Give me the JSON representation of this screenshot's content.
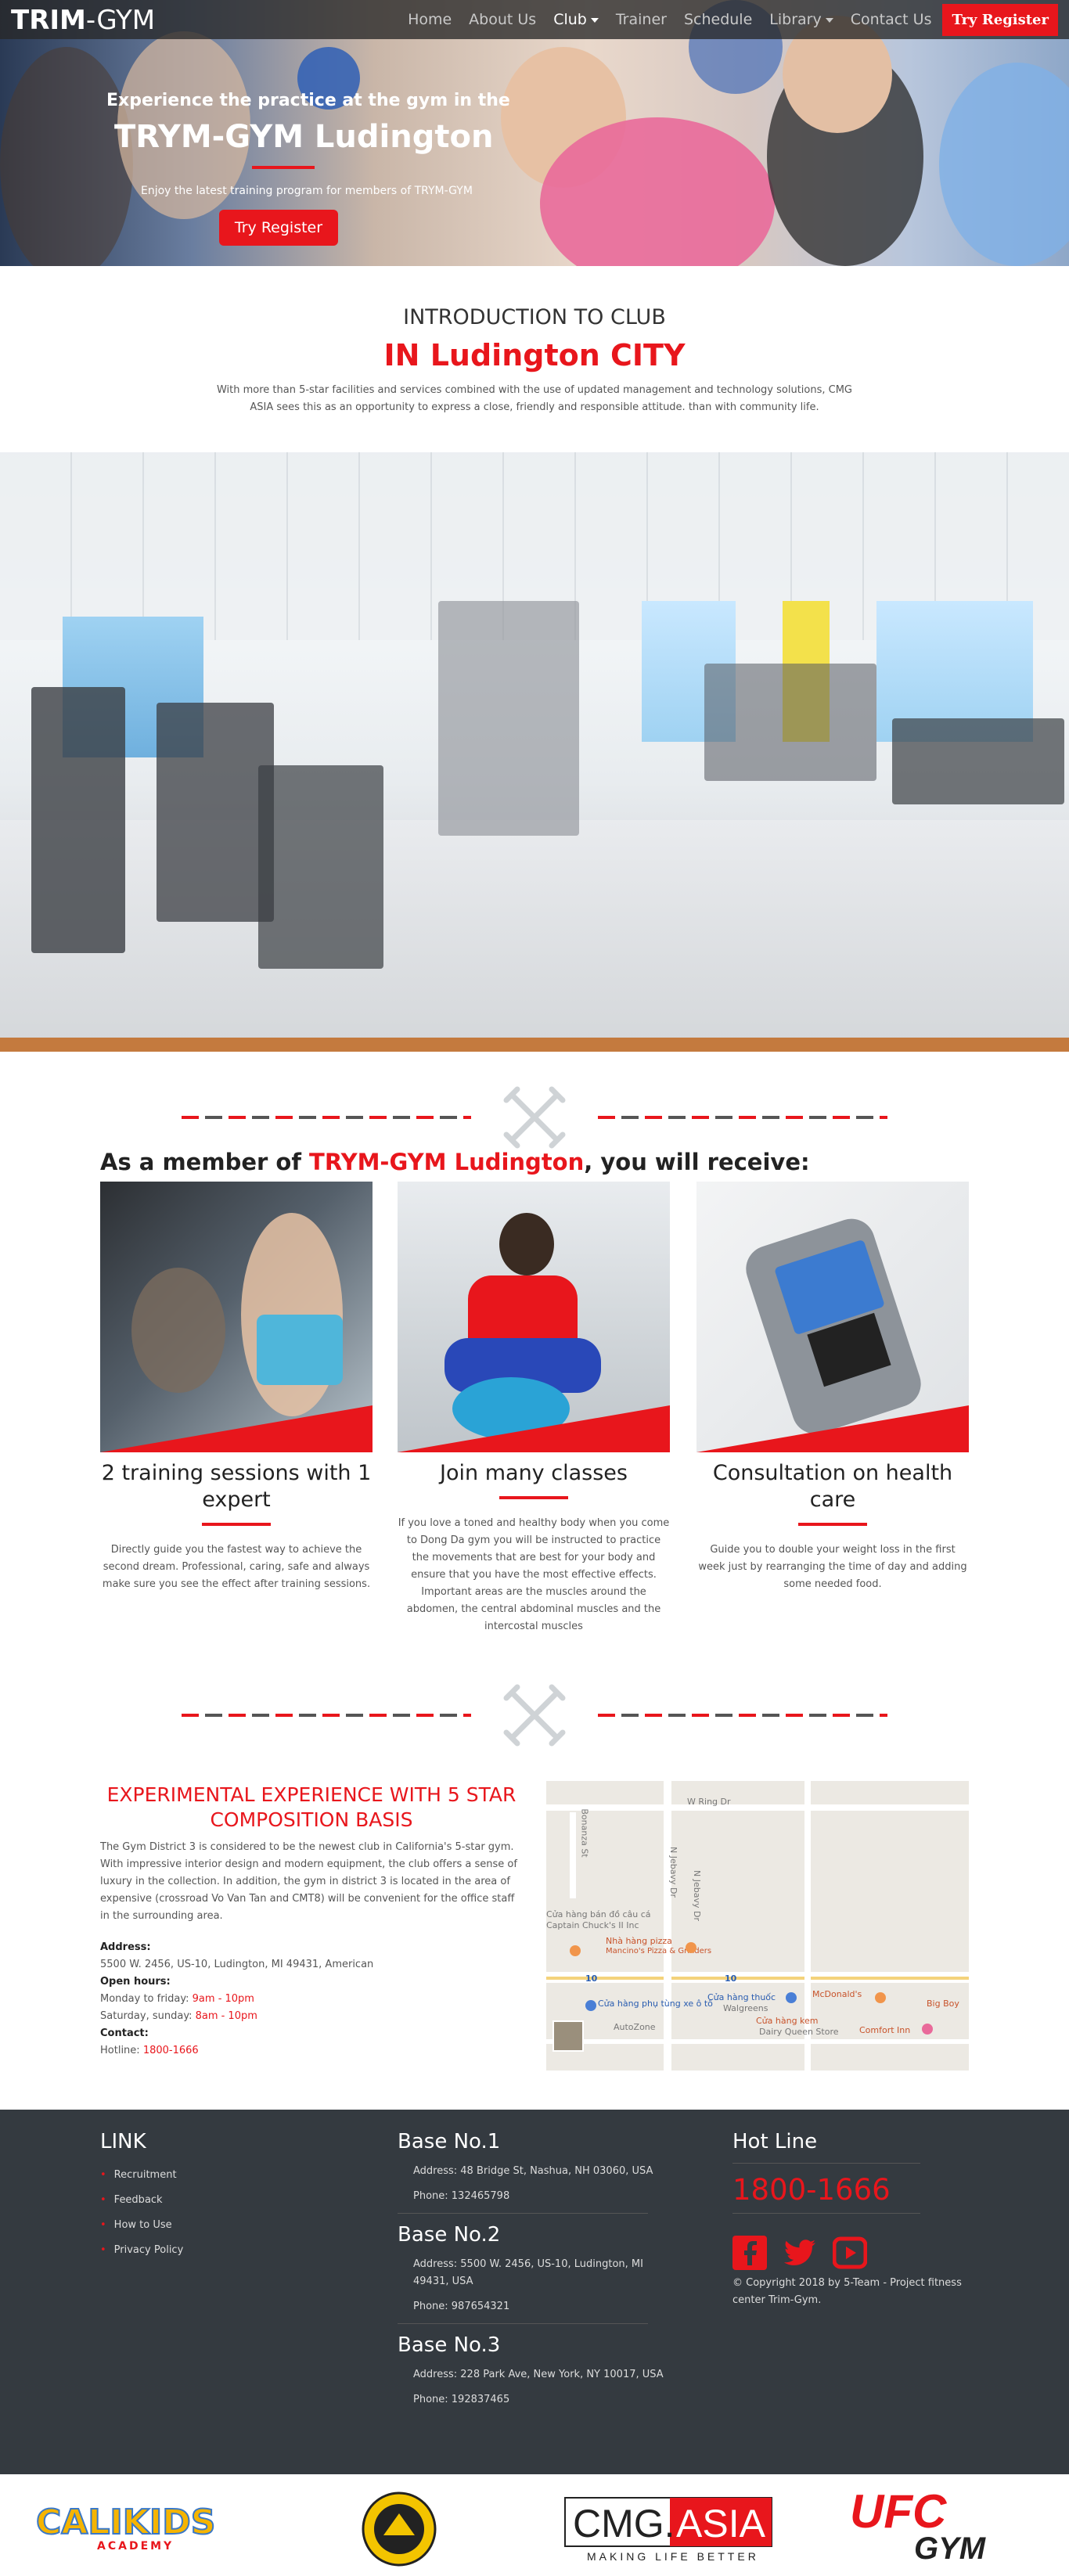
{
  "nav": {
    "brand_bold": "TRIM",
    "brand_rest": "-GYM",
    "items": [
      {
        "label": "Home"
      },
      {
        "label": "About Us"
      },
      {
        "label": "Club"
      },
      {
        "label": "Trainer"
      },
      {
        "label": "Schedule"
      },
      {
        "label": "Library"
      },
      {
        "label": "Contact Us"
      }
    ],
    "register": "Try Register"
  },
  "hero": {
    "subtitle": "Experience the practice at the gym in the",
    "title": "TRYM-GYM Ludington",
    "description": "Enjoy the latest training program for members of TRYM-GYM",
    "button": "Try Register"
  },
  "intro": {
    "heading": "INTRODUCTION TO CLUB",
    "city": "IN Ludington CITY",
    "text": "With more than 5-star facilities and services combined with the use of updated management and technology solutions, CMG ASIA sees this as an opportunity to express a close, friendly and responsible attitude. than with community life."
  },
  "member": {
    "heading_prefix": "As a member of ",
    "heading_brand": "TRYM-GYM Ludington",
    "heading_suffix": ", you will receive:",
    "cards": [
      {
        "title": "2 training sessions with 1 expert",
        "text": "Directly guide you the fastest way to achieve the second dream. Professional, caring, safe and always make sure you see the effect after training sessions."
      },
      {
        "title": "Join many classes",
        "text": "If you love a toned and healthy body when you come to Dong Da gym you will be instructed to practice the movements that are best for your body and ensure that you have the most effective effects. Important areas are the muscles around the abdomen, the central abdominal muscles and the intercostal muscles"
      },
      {
        "title": "Consultation on health care",
        "text": "Guide you to double your weight loss in the first week just by rearranging the time of day and adding some needed food."
      }
    ]
  },
  "experience": {
    "heading": "EXPERIMENTAL EXPERIENCE WITH 5 STAR COMPOSITION BASIS",
    "text": "The Gym District 3 is considered to be the newest club in California's 5-star gym. With impressive interior design and modern equipment, the club offers a sense of luxury in the collection. In addition, the gym in district 3 is located in the area of expensive (crossroad Vo Van Tan and CMT8) will be convenient for the office staff in the surrounding area.",
    "address_label": "Address:",
    "address": "5500 W. 2456, US-10, Ludington, MI 49431, American",
    "hours_label": "Open hours:",
    "weekday_label": "Monday to friday: ",
    "weekday_hours": "9am - 10pm",
    "weekend_label": "Saturday, sunday: ",
    "weekend_hours": "8am - 10pm",
    "contact_label": "Contact:",
    "hotline_label": "Hotline: ",
    "hotline": "1800-1666"
  },
  "map": {
    "labels": [
      "W Ring Dr",
      "Bonanza St",
      "N Jebavy Dr",
      "N Jebavy Dr",
      "Cửa hàng bán đồ câu cá",
      "Captain Chuck's II Inc",
      "Nhà hàng pizza",
      "Mancino's Pizza & Grinders",
      "Cửa hàng phụ tùng xe ô tô",
      "AutoZone",
      "Cửa hàng thuốc",
      "Walgreens",
      "Cửa hàng kem",
      "Dairy Queen Store",
      "McDonald's",
      "Big Boy",
      "Comfort Inn",
      "10",
      "10"
    ]
  },
  "footer": {
    "link_heading": "LINK",
    "links": [
      "Recruitment",
      "Feedback",
      "How to Use",
      "Privacy Policy"
    ],
    "bases": [
      {
        "title": "Base No.1",
        "address": "Address: 48 Bridge St, Nashua, NH 03060, USA",
        "phone": "Phone: 132465798"
      },
      {
        "title": "Base No.2",
        "address": "Address: 5500 W. 2456, US-10, Ludington, MI 49431, USA",
        "phone": "Phone: 987654321"
      },
      {
        "title": "Base No.3",
        "address": "Address: 228 Park Ave, New York, NY 10017, USA",
        "phone": "Phone: 192837465"
      }
    ],
    "hotline_heading": "Hot Line",
    "hotline": "1800-1666",
    "copyright": "© Copyright 2018 by 5-Team - Project fitness center Trim-Gym."
  },
  "partners": {
    "calikids": "CALIKIDS",
    "calikids_sub": "ACADEMY",
    "cmg_left": "CMG.",
    "cmg_right": "ASIA",
    "cmg_tagline": "MAKING LIFE BETTER",
    "ufc": "UFC",
    "ufc_gym": "GYM"
  },
  "colors": {
    "accent": "#e8161c",
    "footer_bg": "#343a40",
    "nav_bg": "#282828"
  }
}
